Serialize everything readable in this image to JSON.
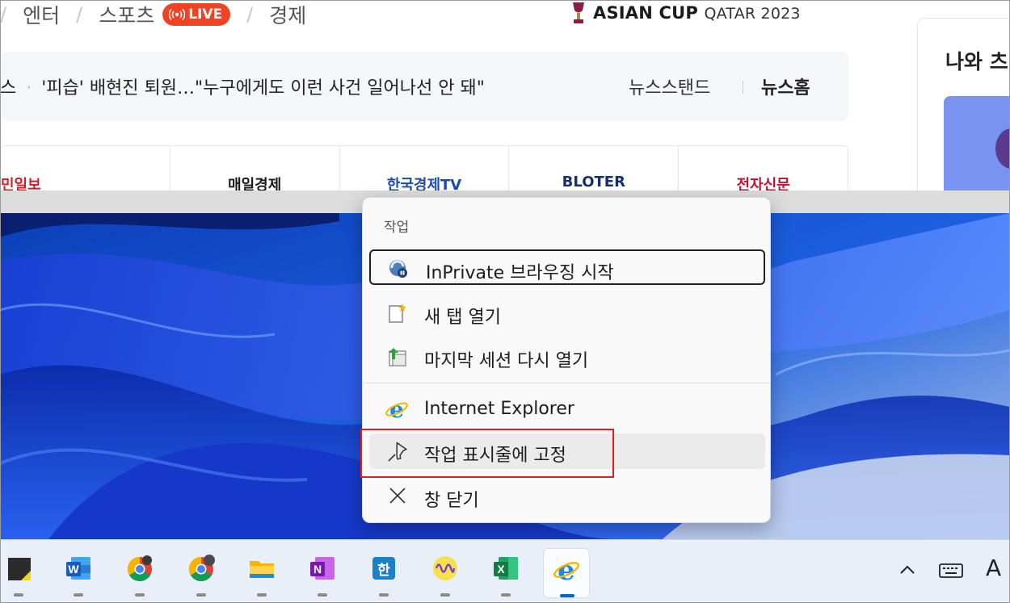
{
  "browser": {
    "nav": {
      "entertainment": "엔터",
      "sports": "스포츠",
      "live_badge": "LIVE",
      "economy": "경제"
    },
    "asian_cup": {
      "main": "ASIAN CUP",
      "sub": "QATAR 2023"
    },
    "ticker": {
      "prev_fragment": "스",
      "headline": "'피습' 배현진 퇴원…\"누구에게도 이런 사건 일어나선 안 돼\"",
      "news_stand": "뉴스스탠드",
      "news_home": "뉴스홈"
    },
    "press_logos": [
      {
        "name": "민일보",
        "color": "#d11f2a"
      },
      {
        "name": "매일경제",
        "color": "#1a1a1a"
      },
      {
        "name": "한국경제TV",
        "color": "#1f4aa8"
      },
      {
        "name": "BLOTER",
        "color": "#15306b"
      },
      {
        "name": "전자신문",
        "color": "#c4122f"
      }
    ],
    "right_panel": {
      "title": "나와 츠"
    }
  },
  "jumplist": {
    "header": "작업",
    "items": [
      {
        "label": "InPrivate 브라우징 시작",
        "icon": "inprivate-icon"
      },
      {
        "label": "새 탭 열기",
        "icon": "new-tab-icon"
      },
      {
        "label": "마지막 세션 다시 열기",
        "icon": "reopen-session-icon"
      },
      {
        "label": "Internet Explorer",
        "icon": "internet-explorer-icon"
      },
      {
        "label": "작업 표시줄에 고정",
        "icon": "pin-icon"
      },
      {
        "label": "창 닫기",
        "icon": "close-icon"
      }
    ],
    "highlight_color": "#e01e1e"
  },
  "taskbar": {
    "apps": [
      {
        "name": "sticky-notes",
        "icon": "sticky-notes-icon"
      },
      {
        "name": "word",
        "icon": "word-icon",
        "letter": "W",
        "color": "#185abd"
      },
      {
        "name": "chrome-1",
        "icon": "chrome-icon"
      },
      {
        "name": "chrome-2",
        "icon": "chrome-icon"
      },
      {
        "name": "file-explorer",
        "icon": "folder-icon"
      },
      {
        "name": "onenote",
        "icon": "onenote-icon",
        "letter": "N",
        "color": "#7719aa"
      },
      {
        "name": "hangul",
        "icon": "hangul-icon",
        "letter": "한",
        "color": "#1d7fc6"
      },
      {
        "name": "audio-app",
        "icon": "audio-wave-icon"
      },
      {
        "name": "excel",
        "icon": "excel-icon",
        "letter": "X",
        "color": "#107c41"
      },
      {
        "name": "internet-explorer",
        "icon": "internet-explorer-icon",
        "active": true
      }
    ],
    "tray": {
      "ime_label": "A"
    }
  }
}
